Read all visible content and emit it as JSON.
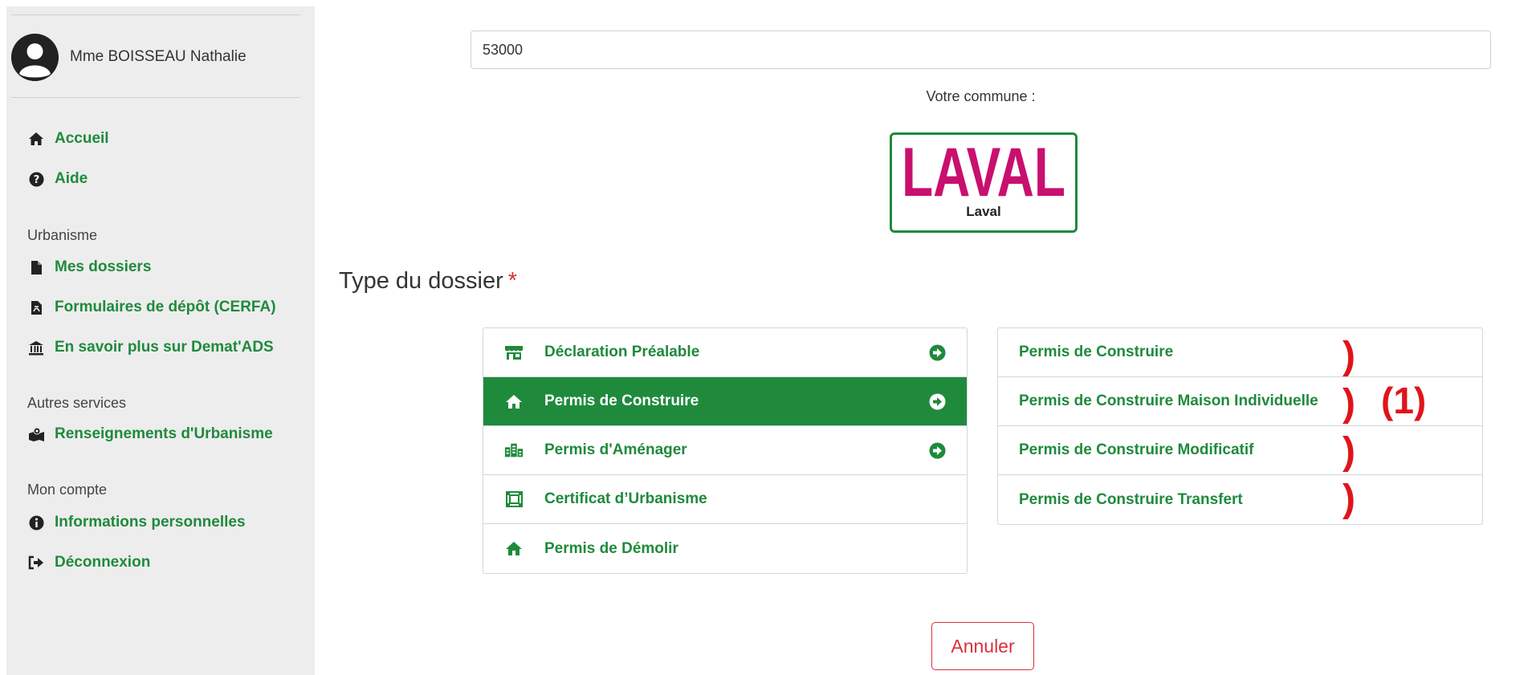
{
  "user": {
    "name": "Mme BOISSEAU Nathalie"
  },
  "sidebar": {
    "top_items": [
      {
        "label": "Accueil",
        "icon": "home-icon"
      },
      {
        "label": "Aide",
        "icon": "question-circle-icon"
      }
    ],
    "sections": [
      {
        "title": "Urbanisme",
        "items": [
          {
            "label": "Mes dossiers",
            "icon": "file-icon"
          },
          {
            "label": "Formulaires de dépôt (CERFA)",
            "icon": "file-pdf-icon"
          },
          {
            "label": "En savoir plus sur Demat'ADS",
            "icon": "bank-icon"
          }
        ]
      },
      {
        "title": "Autres services",
        "items": [
          {
            "label": "Renseignements d'Urbanisme",
            "icon": "map-marker-icon"
          }
        ]
      },
      {
        "title": "Mon compte",
        "items": [
          {
            "label": "Informations personnelles",
            "icon": "info-circle-icon"
          },
          {
            "label": "Déconnexion",
            "icon": "sign-out-icon"
          }
        ]
      }
    ]
  },
  "main": {
    "postal_code": "53000",
    "commune_label": "Votre commune :",
    "commune_logo_text": "LAVAL",
    "commune_name": "Laval",
    "type_title": "Type du dossier",
    "required_marker": "*",
    "dossier_types": [
      {
        "label": "Déclaration Préalable",
        "icon": "storefront-icon",
        "has_arrow": true,
        "active": false
      },
      {
        "label": "Permis de Construire",
        "icon": "home-icon",
        "has_arrow": true,
        "active": true
      },
      {
        "label": "Permis d'Aménager",
        "icon": "buildings-icon",
        "has_arrow": true,
        "active": false
      },
      {
        "label": "Certificat d’Urbanisme",
        "icon": "certificate-icon",
        "has_arrow": false,
        "active": false
      },
      {
        "label": "Permis de Démolir",
        "icon": "home-icon",
        "has_arrow": false,
        "active": false
      }
    ],
    "sub_types": [
      {
        "label": "Permis de Construire"
      },
      {
        "label": "Permis de Construire Maison Individuelle"
      },
      {
        "label": "Permis de Construire Modificatif"
      },
      {
        "label": "Permis de Construire Transfert"
      }
    ],
    "annotation_paren": ")",
    "annotation_note": "(1)",
    "cancel_label": "Annuler"
  },
  "colors": {
    "accent": "#1f8a3c",
    "danger": "#d9303a",
    "annotation": "#e0141b",
    "logo": "#c8106e"
  }
}
